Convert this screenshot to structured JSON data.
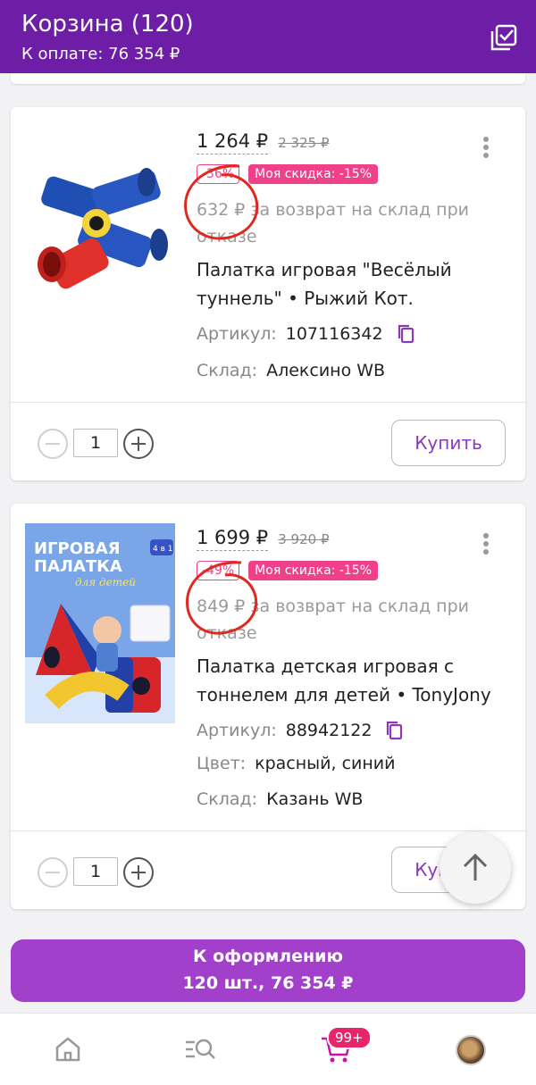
{
  "header": {
    "title": "Корзина (120)",
    "subtitle": "К оплате: 76 354 ₽",
    "bg_color": "#6e1ea6",
    "icon": "checkbox-checked-icon"
  },
  "items": [
    {
      "price": "1 264 ₽",
      "old_price": "2 325 ₽",
      "discount": "-36%",
      "my_discount": "Моя скидка: -15%",
      "return_note": "632 ₽ за возврат на склад при отказе",
      "name": "Палатка игровая \"Весёлый туннель\" • Рыжий Кот.",
      "article_label": "Артикул:",
      "article": "107116342",
      "warehouse_label": "Склад:",
      "warehouse": "Алексино WB",
      "quantity": "1",
      "buy_label": "Купить"
    },
    {
      "price": "1 699 ₽",
      "old_price": "3 920 ₽",
      "discount": "-49%",
      "my_discount": "Моя скидка: -15%",
      "return_note": "849 ₽ за возврат на склад при отказе",
      "image_heading_1": "ИГРОВАЯ",
      "image_heading_2": "ПАЛАТКА",
      "image_heading_3": "для детей",
      "image_badge": "4 в 1",
      "name": "Палатка детская игровая с тоннелем для детей • TonyJony",
      "article_label": "Артикул:",
      "article": "88942122",
      "color_label": "Цвет:",
      "color": "красный, синий",
      "warehouse_label": "Склад:",
      "warehouse": "Казань WB",
      "quantity": "1",
      "buy_label": "Купить"
    }
  ],
  "checkout": {
    "line1": "К оформлению",
    "line2": "120 шт., 76 354 ₽",
    "color": "#a23fcb"
  },
  "bottom_nav": {
    "items": [
      "home-icon",
      "catalog-search-icon",
      "cart-icon",
      "profile-avatar"
    ],
    "cart_badge": "99+",
    "active_color": "#cb11ab"
  },
  "accent_color": "#f0408a"
}
